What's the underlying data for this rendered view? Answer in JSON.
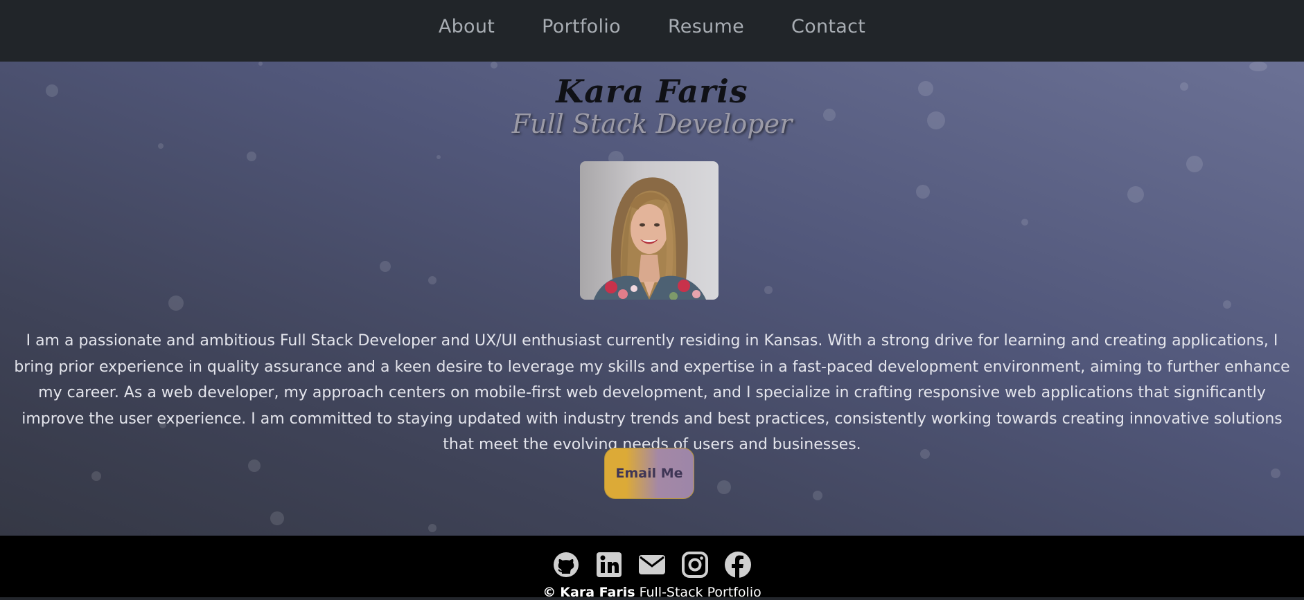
{
  "nav": {
    "items": [
      {
        "label": "About"
      },
      {
        "label": "Portfolio"
      },
      {
        "label": "Resume"
      },
      {
        "label": "Contact"
      }
    ]
  },
  "hero": {
    "name": "Kara Faris",
    "role": "Full Stack Developer",
    "bio": "I am a passionate and ambitious Full Stack Developer and UX/UI enthusiast currently residing in Kansas. With a strong drive for learning and creating applications, I bring prior experience in quality assurance and a keen desire to leverage my skills and expertise in a fast-paced development environment, aiming to further enhance my career. As a web developer, my approach centers on mobile-first web development, and I specialize in crafting responsive web applications that significantly improve the user experience. I am committed to staying updated with industry trends and best practices, consistently working towards creating innovative solutions that meet the evolving needs of users and businesses.",
    "email_button": "Email Me"
  },
  "footer": {
    "icons": [
      "github-icon",
      "linkedin-icon",
      "envelope-icon",
      "instagram-icon",
      "facebook-icon"
    ],
    "copyright_symbol": "©",
    "copyright_name": "Kara Faris",
    "copyright_text": "Full-Stack Portfolio"
  },
  "colors": {
    "nav_bg": "#212529",
    "footer_bg": "#000000",
    "button_gold": "#dcaa37",
    "button_purple": "#9d86a8"
  }
}
